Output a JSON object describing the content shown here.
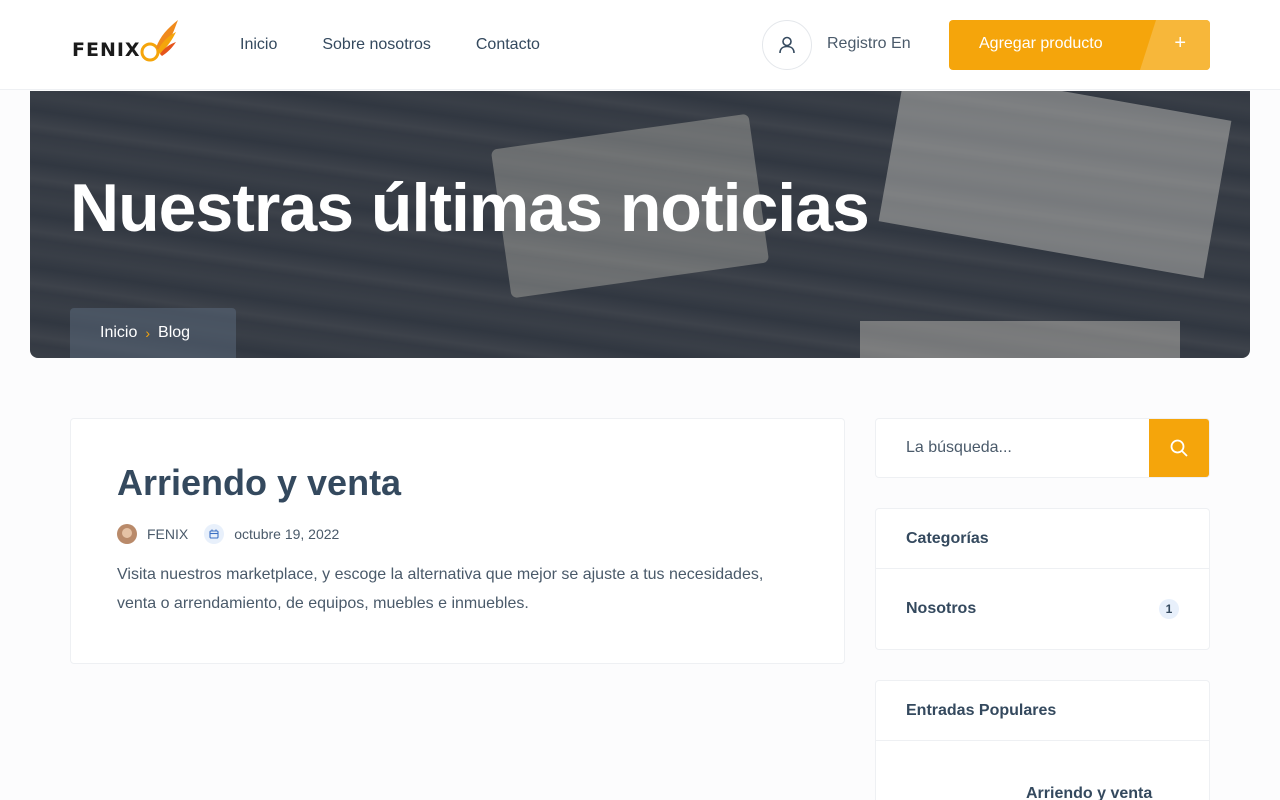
{
  "header": {
    "logo_text": "FENIX",
    "nav": [
      {
        "label": "Inicio"
      },
      {
        "label": "Sobre nosotros"
      },
      {
        "label": "Contacto"
      }
    ],
    "login_label": "Registro En",
    "add_button_label": "Agregar producto",
    "add_button_icon": "+",
    "accent_color": "#f5a50b"
  },
  "hero": {
    "title": "Nuestras últimas noticias",
    "breadcrumb": [
      {
        "label": "Inicio"
      },
      {
        "label": "Blog"
      }
    ],
    "breadcrumb_separator": "›"
  },
  "post": {
    "title": "Arriendo y venta",
    "author": "FENIX",
    "date": "octubre 19, 2022",
    "excerpt": "Visita nuestros marketplace, y escoge la alternativa que mejor se ajuste a tus necesidades, venta o arrendamiento, de equipos, muebles e inmuebles."
  },
  "sidebar": {
    "search_placeholder": "La búsqueda...",
    "categories": {
      "title": "Categorías",
      "items": [
        {
          "name": "Nosotros",
          "count": "1"
        }
      ]
    },
    "popular": {
      "title": "Entradas Populares",
      "items": [
        {
          "title": "Arriendo y venta"
        }
      ]
    }
  }
}
